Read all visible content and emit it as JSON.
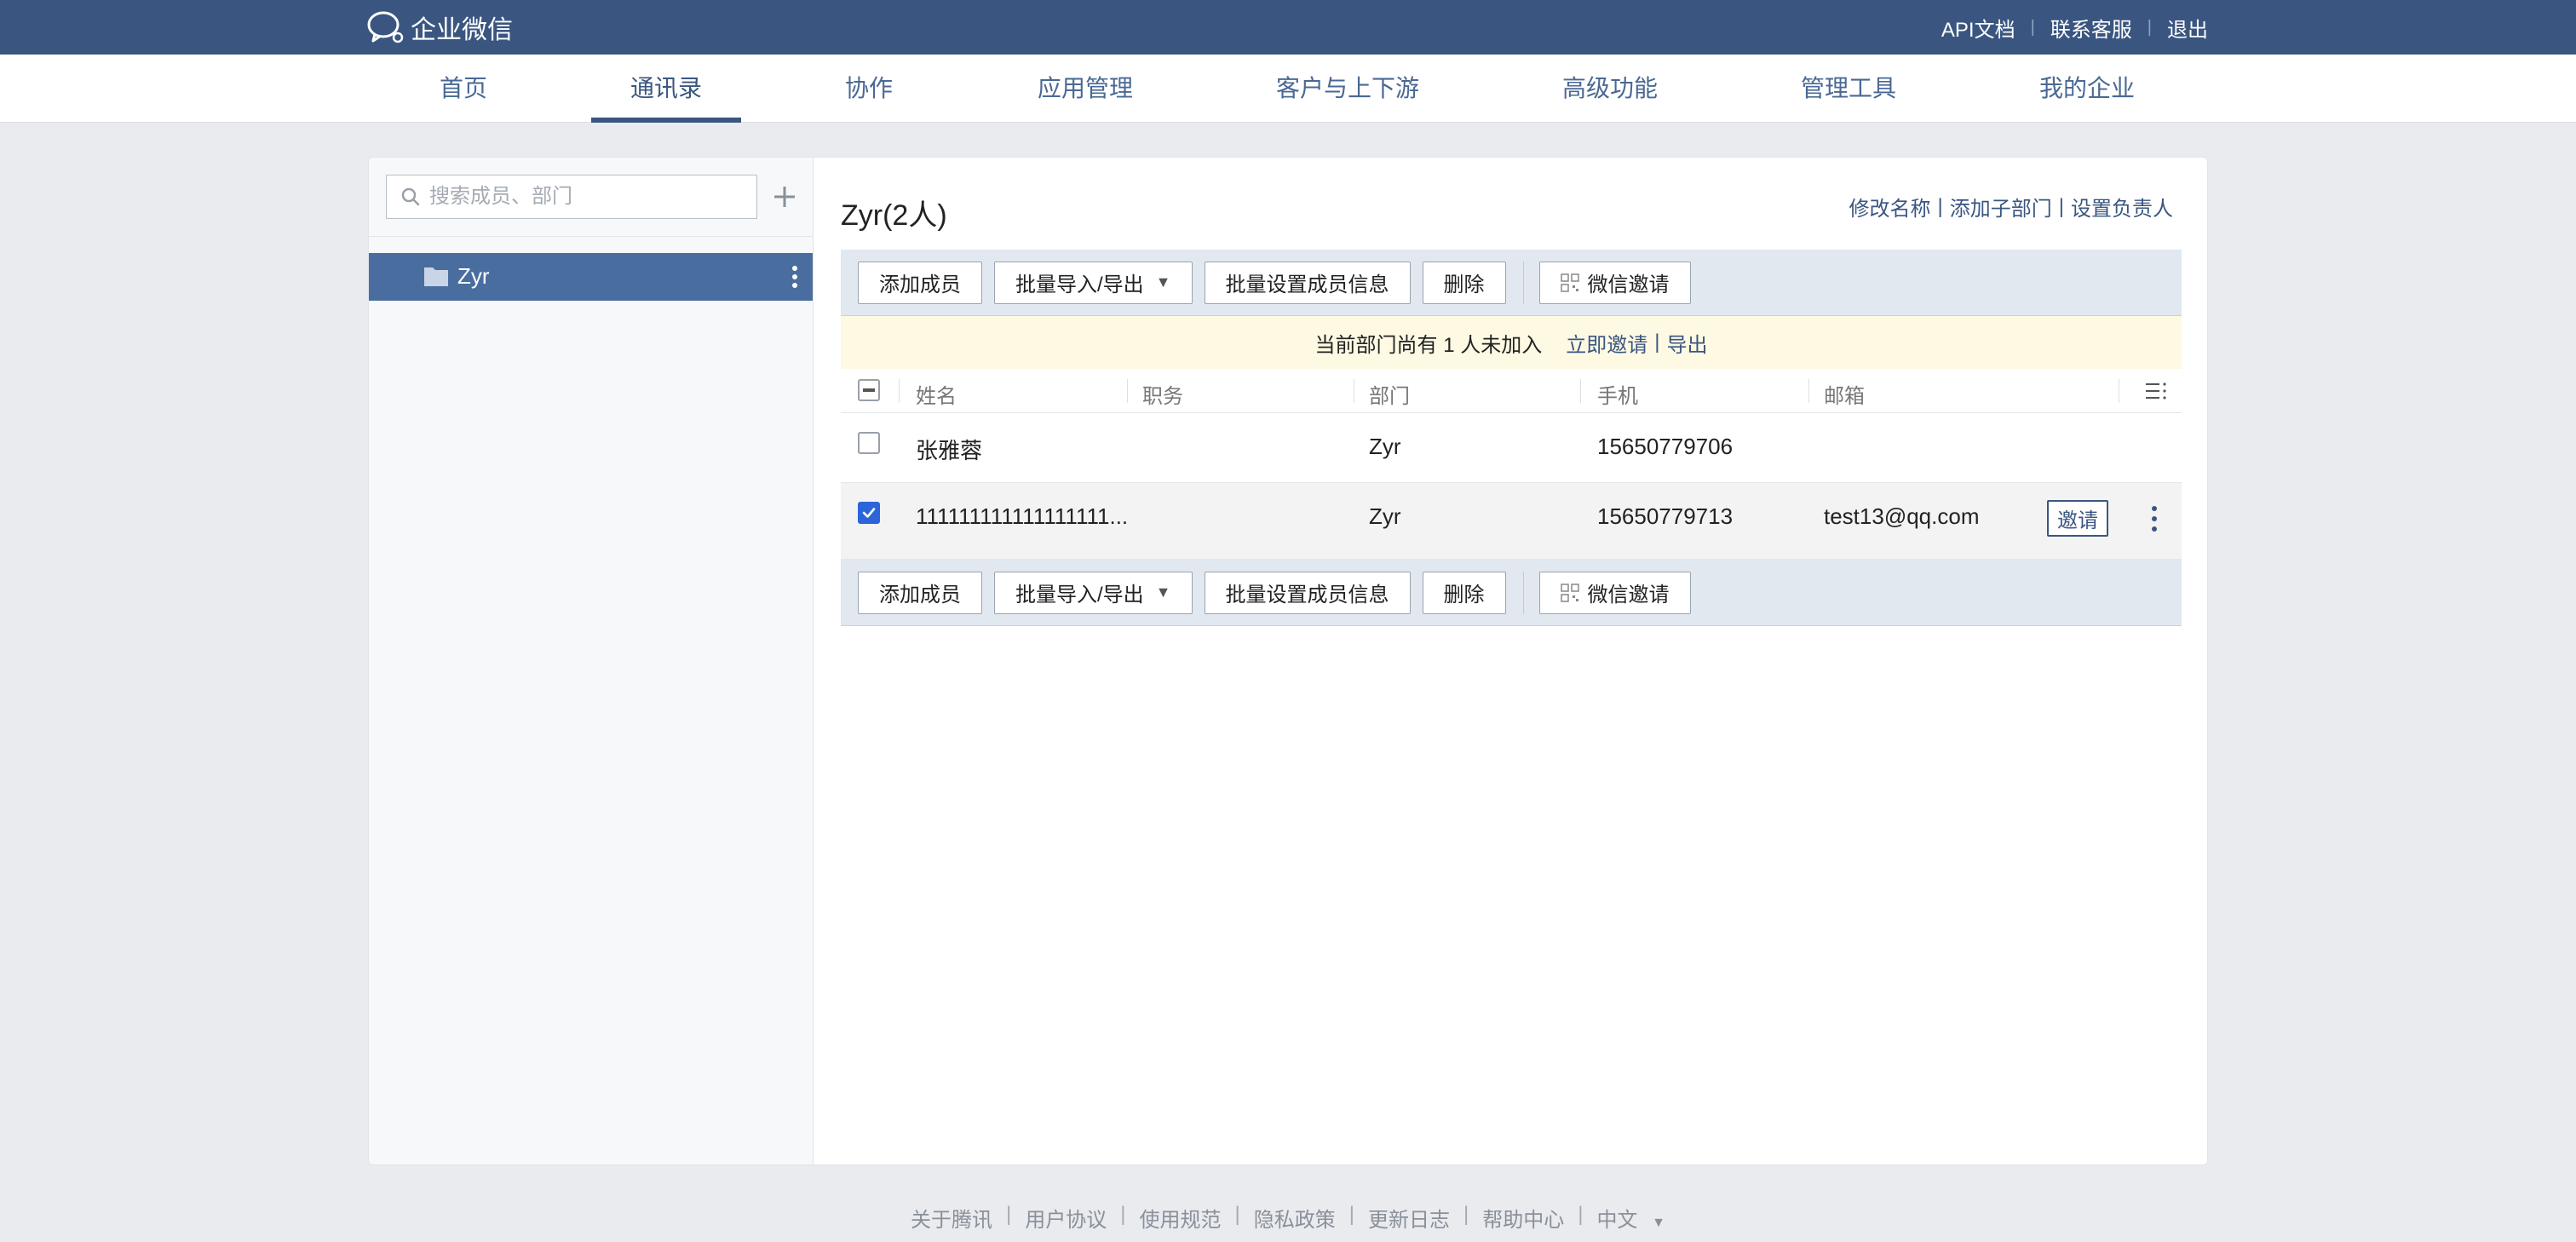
{
  "topbar": {
    "brand": "企业微信",
    "links": [
      "API文档",
      "联系客服",
      "退出"
    ],
    "separator": "|"
  },
  "nav": {
    "items": [
      "首页",
      "通讯录",
      "协作",
      "应用管理",
      "客户与上下游",
      "高级功能",
      "管理工具",
      "我的企业"
    ],
    "active": "通讯录"
  },
  "sidebar": {
    "search_placeholder": "搜索成员、部门",
    "departments": [
      {
        "name": "Zyr",
        "selected": true
      }
    ]
  },
  "dept": {
    "title": "Zyr(2人)",
    "actions": [
      "修改名称",
      "添加子部门",
      "设置负责人"
    ],
    "separator": "|"
  },
  "toolbar": {
    "add_member": "添加成员",
    "batch_import_export": "批量导入/导出",
    "batch_set_info": "批量设置成员信息",
    "delete": "删除",
    "wechat_invite": "微信邀请",
    "caret": "▼"
  },
  "notice": {
    "text": "当前部门尚有 1 人未加入",
    "invite_now": "立即邀请",
    "separator": "|",
    "export": "导出"
  },
  "table": {
    "columns": [
      "姓名",
      "职务",
      "部门",
      "手机",
      "邮箱"
    ],
    "header_checkbox": "partial",
    "rows": [
      {
        "name": "张雅蓉",
        "title": "",
        "dept": "Zyr",
        "phone": "15650779706",
        "email": "",
        "checked": false,
        "invite": ""
      },
      {
        "name": "111111111111111111...",
        "title": "",
        "dept": "Zyr",
        "phone": "15650779713",
        "email": "test13@qq.com",
        "checked": true,
        "invite": "邀请"
      }
    ]
  },
  "footer": {
    "links": [
      "关于腾讯",
      "用户协议",
      "使用规范",
      "隐私政策",
      "更新日志",
      "帮助中心"
    ],
    "language": "中文",
    "separator": "|",
    "caret": "▼"
  },
  "colors": {
    "brand_blue": "#3a5680",
    "selected_dept": "#4a6da0",
    "toolbar_bg": "#e2e8f0",
    "notice_bg": "#fdf9e3",
    "checkbox_checked": "#2b65d9"
  }
}
